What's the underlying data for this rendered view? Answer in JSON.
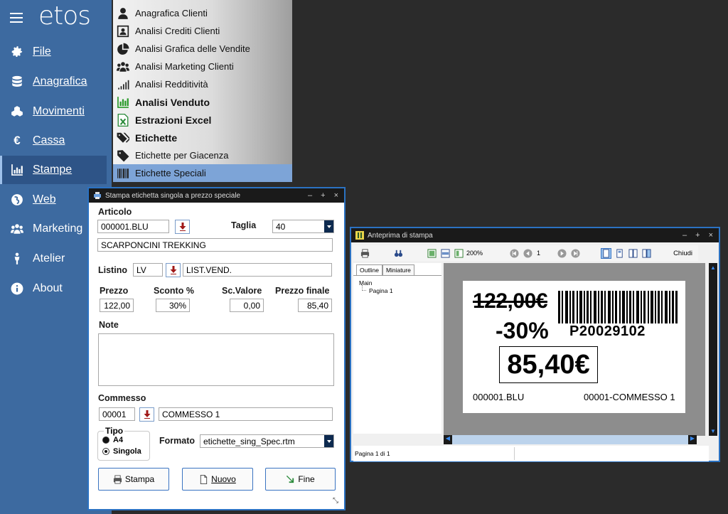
{
  "app": {
    "logo": "etos",
    "nav": [
      {
        "label": "File",
        "icon": "gear-icon"
      },
      {
        "label": "Anagrafica",
        "icon": "database-icon"
      },
      {
        "label": "Movimenti",
        "icon": "cubes-icon"
      },
      {
        "label": "Cassa",
        "icon": "euro-icon"
      },
      {
        "label": "Stampe",
        "icon": "bar-chart-icon"
      },
      {
        "label": "Web",
        "icon": "globe-icon"
      },
      {
        "label": "Marketing",
        "icon": "users-icon"
      },
      {
        "label": "Atelier",
        "icon": "person-icon"
      },
      {
        "label": "About",
        "icon": "info-icon"
      }
    ],
    "active_nav": "Stampe"
  },
  "menu": {
    "items": [
      {
        "label": "Anagrafica Clienti",
        "icon": "user-icon"
      },
      {
        "label": "Analisi Crediti Clienti",
        "icon": "contact-card-icon"
      },
      {
        "label": "Analisi Grafica delle Vendite",
        "icon": "pie-chart-icon"
      },
      {
        "label": "Analisi Marketing Clienti",
        "icon": "users-icon"
      },
      {
        "label": "Analisi Redditività",
        "icon": "signal-bars-icon"
      },
      {
        "label": "Analisi Venduto",
        "icon": "bar-chart-icon"
      },
      {
        "label": "Estrazioni Excel",
        "icon": "excel-icon"
      },
      {
        "label": "Etichette",
        "icon": "tags-icon"
      },
      {
        "label": "Etichette per Giacenza",
        "icon": "tag-icon"
      },
      {
        "label": "Etichette Speciali",
        "icon": "barcode-icon"
      }
    ],
    "selected": "Etichette Speciali"
  },
  "dialog": {
    "title": "Stampa etichetta singola a prezzo speciale",
    "articolo_label": "Articolo",
    "articolo_code": "000001.BLU",
    "taglia_label": "Taglia",
    "taglia_value": "40",
    "descrizione": "SCARPONCINI TREKKING",
    "listino_label": "Listino",
    "listino_code": "LV",
    "listino_desc": "LIST.VEND.",
    "prezzo_label": "Prezzo",
    "sconto_label": "Sconto %",
    "scvalore_label": "Sc.Valore",
    "prezzo_finale_label": "Prezzo finale",
    "prezzo": "122,00",
    "sconto": "30%",
    "scvalore": "0,00",
    "prezzo_finale": "85,40",
    "note_label": "Note",
    "note_value": "",
    "commesso_label": "Commesso",
    "commesso_code": "00001",
    "commesso_desc": "COMMESSO 1",
    "tipo_label": "Tipo",
    "tipo_a4": "A4",
    "tipo_singola": "Singola",
    "formato_label": "Formato",
    "formato_value": "etichette_sing_Spec.rtm",
    "btn_stampa": "Stampa",
    "btn_nuovo": "Nuovo",
    "btn_fine": "Fine"
  },
  "preview": {
    "title": "Anteprima di stampa",
    "zoom": "200%",
    "page_number": "1",
    "close_label": "Chiudi",
    "tab_outline": "Outline",
    "tab_miniature": "Miniature",
    "tree_root": "Main",
    "tree_child": "Pagina 1",
    "status": "Pagina 1 di 1",
    "label": {
      "old_price": "122,00€",
      "discount": "-30%",
      "barcode_text": "P20029102",
      "new_price": "85,40€",
      "article": "000001.BLU",
      "clerk": "00001-COMMESSO 1"
    }
  }
}
